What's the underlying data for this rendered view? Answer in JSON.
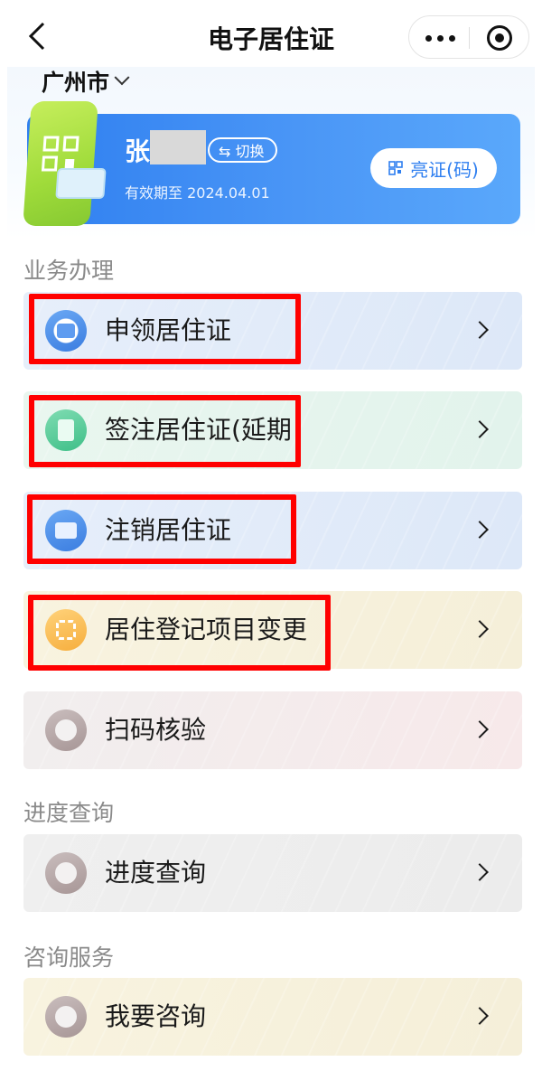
{
  "nav": {
    "title": "电子居住证",
    "back_icon": "chevron-left-icon",
    "more_icon": "more-dots-icon",
    "close_icon": "target-close-icon"
  },
  "city": {
    "name": "广州市"
  },
  "card": {
    "name": "张",
    "switch_label": "⇆ 切换",
    "validity": "有效期至 2024.04.01",
    "show_button": "亮证(码)",
    "accent": "#2f7ff0"
  },
  "sections": {
    "business": "业务办理",
    "progress": "进度查询",
    "consult": "咨询服务"
  },
  "items": [
    {
      "label": "申领居住证"
    },
    {
      "label": "签注居住证(延期"
    },
    {
      "label": "注销居住证"
    },
    {
      "label": "居住登记项目变更"
    },
    {
      "label": "扫码核验"
    },
    {
      "label": "进度查询"
    },
    {
      "label": "我要咨询"
    }
  ],
  "annotation": {
    "highlight_color": "#ff0000"
  }
}
